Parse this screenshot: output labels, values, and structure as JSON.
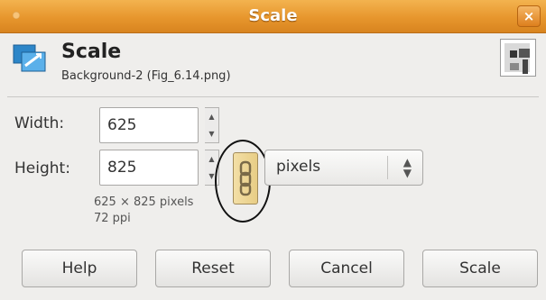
{
  "window": {
    "title": "Scale",
    "close_glyph": "×"
  },
  "header": {
    "title": "Scale",
    "subtitle": "Background-2 (Fig_6.14.png)",
    "icon": "scale-layer-icon",
    "thumbnail": "image-thumbnail"
  },
  "form": {
    "width_label": "Width:",
    "width_value": "625",
    "height_label": "Height:",
    "height_value": "825",
    "chain": "chain-link-icon",
    "units_value": "pixels",
    "size_info": "625 × 825 pixels",
    "resolution_info": "72 ppi"
  },
  "buttons": {
    "help": "Help",
    "reset": "Reset",
    "cancel": "Cancel",
    "scale": "Scale"
  },
  "colors": {
    "titlebar": "#e7962d",
    "annotation_circle": "#111111",
    "chain_button": "#efd99a"
  }
}
